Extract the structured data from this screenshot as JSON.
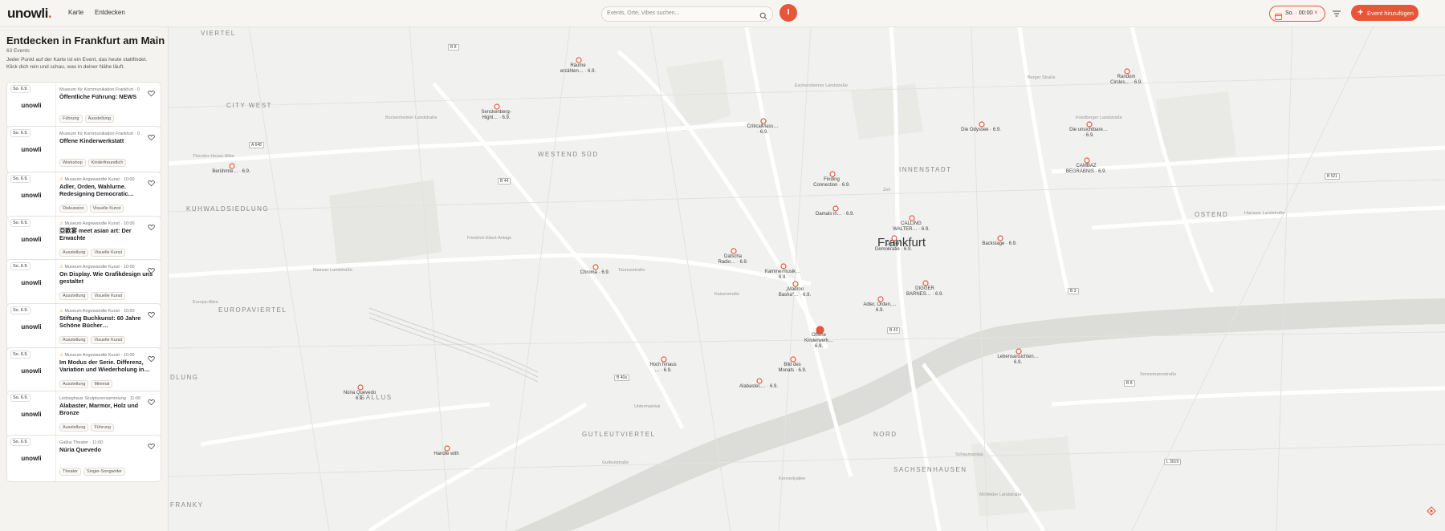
{
  "header": {
    "logo_main": "unowli",
    "logo_dot": ".",
    "nav": [
      {
        "label": "Karte"
      },
      {
        "label": "Entdecken"
      }
    ],
    "search_placeholder": "Events, Orte, Vibes suchen...",
    "avatar_initial": "I",
    "date_filter": "So. · 00:00",
    "add_event_label": "Event hinzufügen"
  },
  "sidebar": {
    "title": "Entdecken in Frankfurt am Main",
    "count": "63 Events",
    "description": "Jeder Punkt auf der Karte ist ein Event, das heute stattfindet. Klick dich rein und schau, was in deiner Nähe läuft.",
    "events": [
      {
        "date": "So. 6.9.",
        "brand": "unowli",
        "venue": "Museum für Kommunikation Frankfurt · 0",
        "title": "Öffentliche Führung: NEWS",
        "tags": [
          "Führung",
          "Ausstellung"
        ],
        "warn": false
      },
      {
        "date": "So. 6.9.",
        "brand": "unowli",
        "venue": "Museum für Kommunikation Frankfurt · 0",
        "title": "Offene Kinderwerkstatt",
        "tags": [
          "Workshop",
          "Kinderfreundlich"
        ],
        "warn": false
      },
      {
        "date": "So. 6.9.",
        "brand": "unowli",
        "venue": "Museum Angewandte Kunst · 10:00",
        "title": "Adler, Orden, Wahlurne. Redesigning Democratic…",
        "tags": [
          "Diskussion",
          "Visuelle Kunst"
        ],
        "warn": true
      },
      {
        "date": "So. 6.9.",
        "brand": "unowli",
        "venue": "Museum Angewandte Kunst · 10:00",
        "title": "亞歐宴 meet asian art: Der Erwachte",
        "tags": [
          "Ausstellung",
          "Visuelle Kunst"
        ],
        "warn": true
      },
      {
        "date": "So. 6.9.",
        "brand": "unowli",
        "venue": "Museum Angewandte Kunst · 10:00",
        "title": "On Display. Wie Grafikdesign uns gestaltet",
        "tags": [
          "Ausstellung",
          "Visuelle Kunst"
        ],
        "warn": true
      },
      {
        "date": "So. 6.9.",
        "brand": "unowli",
        "venue": "Museum Angewandte Kunst · 10:00",
        "title": "Stiftung Buchkunst: 60 Jahre Schöne Bücher…",
        "tags": [
          "Ausstellung",
          "Visuelle Kunst"
        ],
        "warn": true
      },
      {
        "date": "So. 6.9.",
        "brand": "unowli",
        "venue": "Museum Angewandte Kunst · 10:00",
        "title": "Im Modus der Serie. Differenz, Variation und Wiederholung in…",
        "tags": [
          "Ausstellung",
          "Minimal"
        ],
        "warn": true
      },
      {
        "date": "So. 6.9.",
        "brand": "unowli",
        "venue": "Liebieghaus Skulpturensammlung · 11:00",
        "title": "Alabaster, Marmor, Holz und Bronze",
        "tags": [
          "Ausstellung",
          "Führung"
        ],
        "warn": false
      },
      {
        "date": "So. 6.9.",
        "brand": "unowli",
        "venue": "Gallus Theater · 11:00",
        "title": "Núria Quevedo",
        "tags": [
          "Theater",
          "Singer-Songwriter"
        ],
        "warn": false
      }
    ]
  },
  "map": {
    "city": "Frankfurt",
    "districts": [
      "CITY WEST",
      "WESTEND SÜD",
      "INNENSTADT",
      "OSTEND",
      "KUHWALDSIEDLUNG",
      "EUROPAVIERTEL",
      "GALLUS",
      "GUTLEUTVIERTEL",
      "NORD",
      "SACHSENHAUSEN",
      "FRANKY",
      "DLUNG",
      "VIERTEL"
    ],
    "markers": [
      {
        "label": "Räume\nerzählen… · 6.9.",
        "active": false
      },
      {
        "label": "Senckenberg-\nHighl… · 6.9.",
        "active": false
      },
      {
        "label": "CriticalMass…\n· 6.9.",
        "active": false
      },
      {
        "label": "Random\nCircles… · 6.9.",
        "active": false
      },
      {
        "label": "Die Odyssee · 6.9.",
        "active": false
      },
      {
        "label": "Die unsichtbare…\n· 6.9.",
        "active": false
      },
      {
        "label": "CAMBAZ\nBEGRÄBNIS · 6.9.",
        "active": false
      },
      {
        "label": "Berühmte… · 6.9.",
        "active": false
      },
      {
        "label": "Finding\nConnection · 6.9.",
        "active": false
      },
      {
        "label": "Damals in… · 6.9.",
        "active": false
      },
      {
        "label": "CALLING\nWALTER… · 6.9.",
        "active": false
      },
      {
        "label": "Design\nDemokratie · 6.9.",
        "active": false
      },
      {
        "label": "Backstage · 6.9.",
        "active": false
      },
      {
        "label": "Datscha\nRadio… · 6.9.",
        "active": false
      },
      {
        "label": "Chroma · 6.9.",
        "active": false
      },
      {
        "label": "Kammermusik…\n6.9.",
        "active": false
      },
      {
        "label": "„Mädroo\nBasha“… · 6.9.",
        "active": false
      },
      {
        "label": "Adler, Orden,…\n6.9.",
        "active": false
      },
      {
        "label": "DIGGER\nBARNES… · 6.9.",
        "active": false
      },
      {
        "label": "Offene\nKinderwerk…\n6.9.",
        "active": true
      },
      {
        "label": "Bild des\nMonats · 6.9.",
        "active": false
      },
      {
        "label": "Hoch hinaus\n… · 6.9.",
        "active": false
      },
      {
        "label": "Alabaster,… · 6.9.",
        "active": false
      },
      {
        "label": "Lebensansichten…\n6.9.",
        "active": false
      },
      {
        "label": "Núria Quevedo\n6.9.",
        "active": false
      },
      {
        "label": "Handle with",
        "active": false
      }
    ],
    "streets": [
      "Theodor-Heuss-Allee",
      "Mainzer Landstraße",
      "Friedrich-Ebert-Anlage",
      "Hanauer Landstraße",
      "Schaumainkai",
      "Untermainkai",
      "Eschersheimer Landstraße",
      "Bockenheimer Landstraße",
      "Europa-Allee",
      "Gutleutstraße",
      "Taunusstraße",
      "Zeil",
      "Kaiserstraße",
      "Berger Straße",
      "Sonnemannstraße",
      "Mörfelder Landstraße",
      "Friedberger Landstraße",
      "Kennedyallee"
    ],
    "road_numbers": [
      "B 8",
      "B 44",
      "A 648",
      "B 43",
      "B 3",
      "L 3019",
      "B 521",
      "B 40a",
      "B 8"
    ],
    "colors": {
      "accent": "#e8553a",
      "marker_active": "#e8553a",
      "marker_outline": "#e8553a"
    }
  }
}
